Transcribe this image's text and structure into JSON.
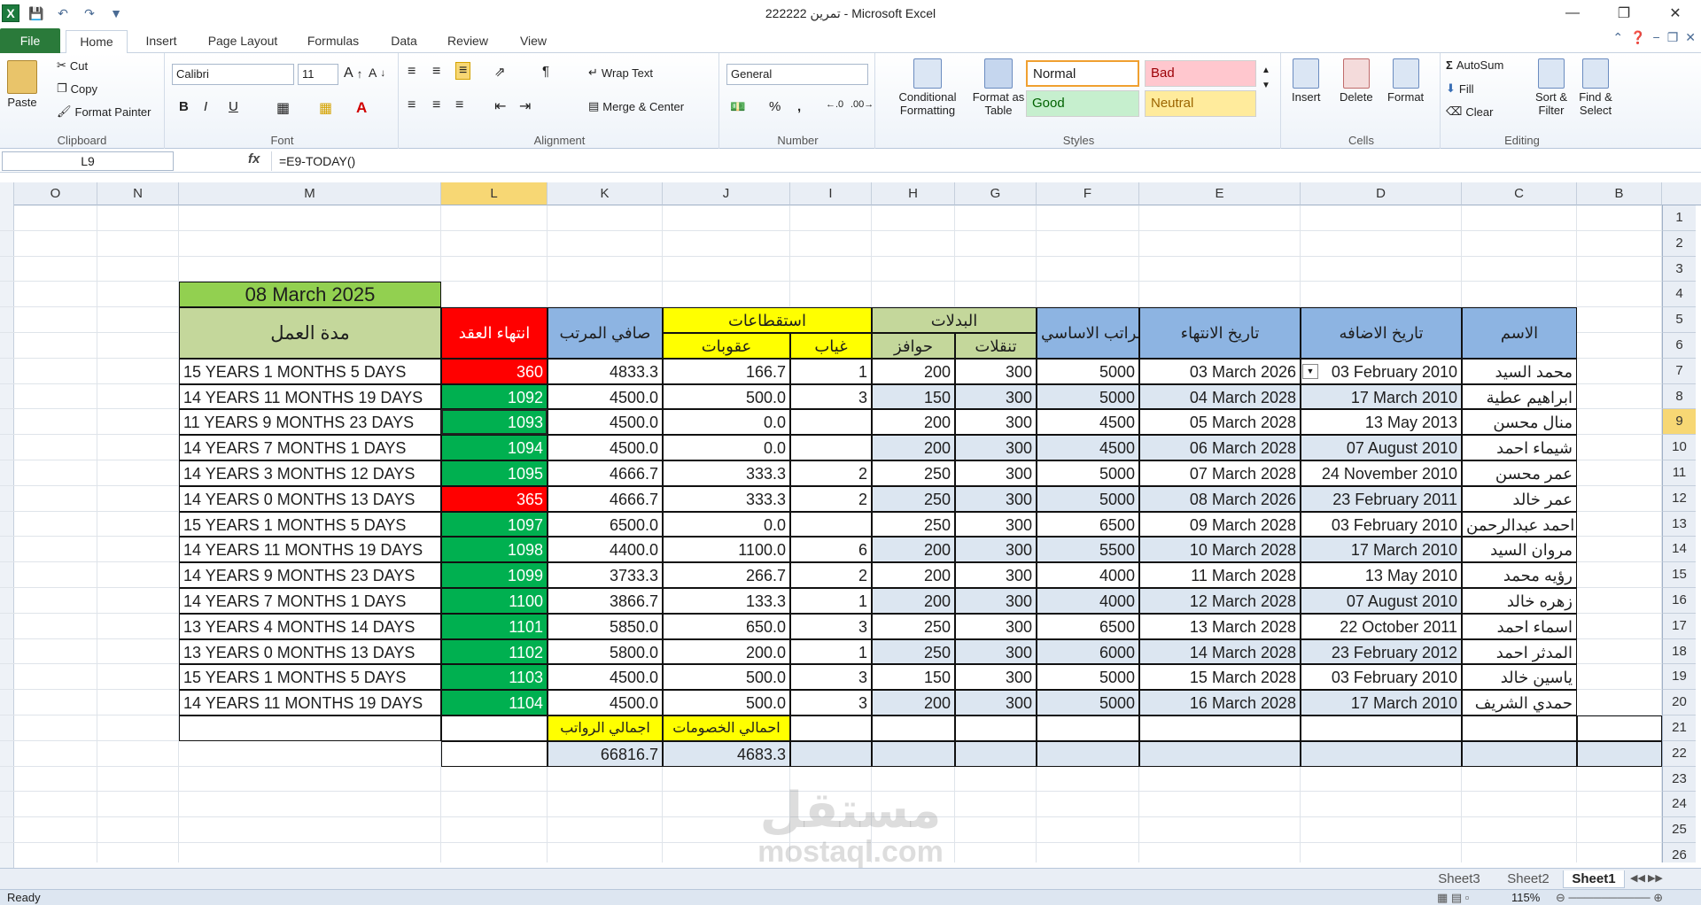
{
  "window": {
    "title": "تمرين 222222  -  Microsoft Excel"
  },
  "tabs": [
    "File",
    "Home",
    "Insert",
    "Page Layout",
    "Formulas",
    "Data",
    "Review",
    "View"
  ],
  "ribbon": {
    "clipboard": {
      "label": "Clipboard",
      "paste": "Paste",
      "cut": "Cut",
      "copy": "Copy",
      "format_painter": "Format Painter"
    },
    "font": {
      "label": "Font",
      "name": "Calibri",
      "size": "11",
      "bold": "B",
      "italic": "I",
      "underline": "U"
    },
    "alignment": {
      "label": "Alignment",
      "wrap": "Wrap Text",
      "merge": "Merge & Center"
    },
    "number": {
      "label": "Number",
      "format": "General",
      "percent": "%",
      "comma": ","
    },
    "styles": {
      "label": "Styles",
      "conditional": "Conditional Formatting",
      "format_table": "Format as Table",
      "normal": "Normal",
      "bad": "Bad",
      "good": "Good",
      "neutral": "Neutral"
    },
    "cells": {
      "label": "Cells",
      "insert": "Insert",
      "delete": "Delete",
      "format": "Format"
    },
    "editing": {
      "label": "Editing",
      "autosum": "AutoSum",
      "fill": "Fill",
      "clear": "Clear",
      "sort": "Sort & Filter",
      "find": "Find & Select"
    }
  },
  "formula": {
    "namebox": "L9",
    "fx": "fx",
    "content": "=E9-TODAY()"
  },
  "columns": [
    "O",
    "N",
    "M",
    "L",
    "K",
    "J",
    "I",
    "H",
    "G",
    "F",
    "E",
    "D",
    "C",
    "B"
  ],
  "rows": [
    "1",
    "2",
    "3",
    "4",
    "5",
    "6",
    "7",
    "8",
    "9",
    "10",
    "11",
    "12",
    "13",
    "14",
    "15",
    "16",
    "17",
    "18",
    "19",
    "20",
    "21",
    "22",
    "23",
    "24",
    "25",
    "26"
  ],
  "sheet": {
    "date_title": "08 March 2025",
    "headers": {
      "name": "الاسم",
      "added": "تاريخ الاضافه",
      "end": "تاريخ الانتهاء",
      "salary": "الراتب الاساسي",
      "allowances": "البدلات",
      "transport": "تنقلات",
      "incentives": "حوافز",
      "deductions": "استقطاعات",
      "absence": "غياب",
      "penalties": "عقوبات",
      "net": "صافي المرتب",
      "contract_end": "انتهاء العقد",
      "duration": "مدة العمل"
    },
    "rows": [
      {
        "name": "محمد السيد",
        "added": "03 February 2010",
        "end": "03 March 2026",
        "salary": "5000",
        "transport": "300",
        "incentives": "200",
        "absence": "1",
        "penalties": "166.7",
        "net": "4833.3",
        "contract": "360",
        "status": "red",
        "duration": "15 YEARS 1 MONTHS 5 DAYS"
      },
      {
        "name": "ابراهيم عطية",
        "added": "17 March 2010",
        "end": "04 March 2028",
        "salary": "5000",
        "transport": "300",
        "incentives": "150",
        "absence": "3",
        "penalties": "500.0",
        "net": "4500.0",
        "contract": "1092",
        "status": "green",
        "duration": "14 YEARS 11 MONTHS 19 DAYS"
      },
      {
        "name": "منال محسن",
        "added": "13 May 2013",
        "end": "05 March 2028",
        "salary": "4500",
        "transport": "300",
        "incentives": "200",
        "absence": "",
        "penalties": "0.0",
        "net": "4500.0",
        "contract": "1093",
        "status": "green",
        "duration": "11 YEARS 9 MONTHS 23 DAYS"
      },
      {
        "name": "شيماء احمد",
        "added": "07 August 2010",
        "end": "06 March 2028",
        "salary": "4500",
        "transport": "300",
        "incentives": "200",
        "absence": "",
        "penalties": "0.0",
        "net": "4500.0",
        "contract": "1094",
        "status": "green",
        "duration": "14 YEARS 7 MONTHS 1 DAYS"
      },
      {
        "name": "عمر محسن",
        "added": "24 November 2010",
        "end": "07 March 2028",
        "salary": "5000",
        "transport": "300",
        "incentives": "250",
        "absence": "2",
        "penalties": "333.3",
        "net": "4666.7",
        "contract": "1095",
        "status": "green",
        "duration": "14 YEARS 3 MONTHS 12 DAYS"
      },
      {
        "name": "عمر خالد",
        "added": "23 February 2011",
        "end": "08 March 2026",
        "salary": "5000",
        "transport": "300",
        "incentives": "250",
        "absence": "2",
        "penalties": "333.3",
        "net": "4666.7",
        "contract": "365",
        "status": "red",
        "duration": "14 YEARS 0 MONTHS 13 DAYS"
      },
      {
        "name": "احمد عبدالرحمن",
        "added": "03 February 2010",
        "end": "09 March 2028",
        "salary": "6500",
        "transport": "300",
        "incentives": "250",
        "absence": "",
        "penalties": "0.0",
        "net": "6500.0",
        "contract": "1097",
        "status": "green",
        "duration": "15 YEARS 1 MONTHS 5 DAYS"
      },
      {
        "name": "مروان السيد",
        "added": "17 March 2010",
        "end": "10 March 2028",
        "salary": "5500",
        "transport": "300",
        "incentives": "200",
        "absence": "6",
        "penalties": "1100.0",
        "net": "4400.0",
        "contract": "1098",
        "status": "green",
        "duration": "14 YEARS 11 MONTHS 19 DAYS"
      },
      {
        "name": "رؤيه محمد",
        "added": "13 May 2010",
        "end": "11 March 2028",
        "salary": "4000",
        "transport": "300",
        "incentives": "200",
        "absence": "2",
        "penalties": "266.7",
        "net": "3733.3",
        "contract": "1099",
        "status": "green",
        "duration": "14 YEARS 9 MONTHS 23 DAYS"
      },
      {
        "name": "زهره خالد",
        "added": "07 August 2010",
        "end": "12 March 2028",
        "salary": "4000",
        "transport": "300",
        "incentives": "200",
        "absence": "1",
        "penalties": "133.3",
        "net": "3866.7",
        "contract": "1100",
        "status": "green",
        "duration": "14 YEARS 7 MONTHS 1 DAYS"
      },
      {
        "name": "اسماء احمد",
        "added": "22 October 2011",
        "end": "13 March 2028",
        "salary": "6500",
        "transport": "300",
        "incentives": "250",
        "absence": "3",
        "penalties": "650.0",
        "net": "5850.0",
        "contract": "1101",
        "status": "green",
        "duration": "13 YEARS 4 MONTHS 14 DAYS"
      },
      {
        "name": "المدثر احمد",
        "added": "23 February 2012",
        "end": "14 March 2028",
        "salary": "6000",
        "transport": "300",
        "incentives": "250",
        "absence": "1",
        "penalties": "200.0",
        "net": "5800.0",
        "contract": "1102",
        "status": "green",
        "duration": "13 YEARS 0 MONTHS 13 DAYS"
      },
      {
        "name": "ياسين خالد",
        "added": "03 February 2010",
        "end": "15 March 2028",
        "salary": "5000",
        "transport": "300",
        "incentives": "150",
        "absence": "3",
        "penalties": "500.0",
        "net": "4500.0",
        "contract": "1103",
        "status": "green",
        "duration": "15 YEARS 1 MONTHS 5 DAYS"
      },
      {
        "name": "حمدي الشريف",
        "added": "17 March 2010",
        "end": "16 March 2028",
        "salary": "5000",
        "transport": "300",
        "incentives": "200",
        "absence": "3",
        "penalties": "500.0",
        "net": "4500.0",
        "contract": "1104",
        "status": "green",
        "duration": "14 YEARS 11 MONTHS 19 DAYS"
      }
    ],
    "totals": {
      "penalties_label": "احمالي الخصومات",
      "net_label": "اجمالي الرواتب",
      "penalties": "4683.3",
      "net": "66816.7"
    }
  },
  "sheets": [
    "Sheet3",
    "Sheet2",
    "Sheet1"
  ],
  "status": {
    "ready": "Ready",
    "zoom": "115%"
  },
  "watermark": {
    "ar": "مستقل",
    "en": "mostaql.com"
  },
  "colors": {
    "green": "#00b050",
    "red": "#ff0000",
    "yellow": "#ffff00",
    "olive": "#c4d79b",
    "blue": "#8db4e2",
    "date_green": "#92d050",
    "file_tab": "#2a7a3a"
  }
}
